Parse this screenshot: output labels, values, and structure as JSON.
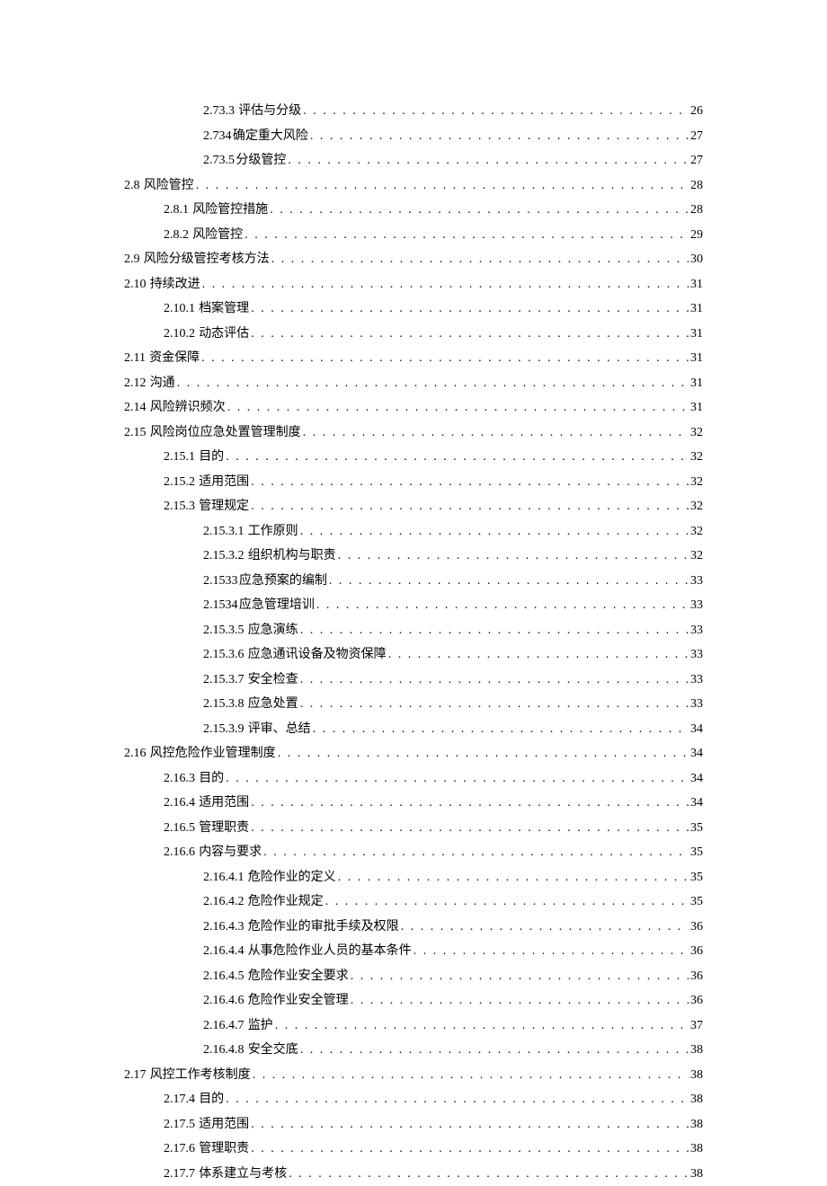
{
  "toc": [
    {
      "indent": 3,
      "num": "2.73.3",
      "title": "评估与分级",
      "page": "26"
    },
    {
      "indent": 3,
      "num": "2.734",
      "title": "确定重大风险",
      "page": "27",
      "tight": true
    },
    {
      "indent": 3,
      "num": "2.73.5",
      "title": "分级管控",
      "page": "27",
      "tight": true
    },
    {
      "indent": 1,
      "num": "2.8",
      "title": "风险管控",
      "page": "28"
    },
    {
      "indent": 2,
      "num": "2.8.1",
      "title": "风险管控措施",
      "page": "28"
    },
    {
      "indent": 2,
      "num": "2.8.2",
      "title": "风险管控",
      "page": "29"
    },
    {
      "indent": 1,
      "num": "2.9",
      "title": "风险分级管控考核方法",
      "page": "30"
    },
    {
      "indent": 1,
      "num": "2.10",
      "title": "持续改进",
      "page": "31"
    },
    {
      "indent": 2,
      "num": "2.10.1",
      "title": "档案管理",
      "page": "31"
    },
    {
      "indent": 2,
      "num": "2.10.2",
      "title": "动态评估",
      "page": "31"
    },
    {
      "indent": 1,
      "num": "2.11",
      "title": "资金保障",
      "page": "31"
    },
    {
      "indent": 1,
      "num": "2.12",
      "title": "沟通",
      "page": "31"
    },
    {
      "indent": 1,
      "num": "2.14",
      "title": "风险辨识频次",
      "page": "31"
    },
    {
      "indent": 1,
      "num": "2.15",
      "title": "风险岗位应急处置管理制度",
      "page": "32"
    },
    {
      "indent": 2,
      "num": "2.15.1",
      "title": "目的",
      "page": "32"
    },
    {
      "indent": 2,
      "num": "2.15.2",
      "title": "适用范围",
      "page": "32"
    },
    {
      "indent": 2,
      "num": "2.15.3",
      "title": "管理规定",
      "page": "32"
    },
    {
      "indent": 3,
      "num": "2.15.3.1",
      "title": "工作原则",
      "page": "32"
    },
    {
      "indent": 3,
      "num": "2.15.3.2",
      "title": "组织机构与职责",
      "page": "32"
    },
    {
      "indent": 3,
      "num": "2.1533",
      "title": "应急预案的编制",
      "page": "33",
      "tight": true
    },
    {
      "indent": 3,
      "num": "2.1534",
      "title": "应急管理培训",
      "page": "33",
      "tight": true
    },
    {
      "indent": 3,
      "num": "2.15.3.5",
      "title": "应急演练",
      "page": "33"
    },
    {
      "indent": 3,
      "num": "2.15.3.6",
      "title": "应急通讯设备及物资保障",
      "page": "33"
    },
    {
      "indent": 3,
      "num": "2.15.3.7",
      "title": "安全检查",
      "page": "33"
    },
    {
      "indent": 3,
      "num": "2.15.3.8",
      "title": "应急处置",
      "page": "33"
    },
    {
      "indent": 3,
      "num": "2.15.3.9",
      "title": "评审、总结",
      "page": "34"
    },
    {
      "indent": 1,
      "num": "2.16",
      "title": "风控危险作业管理制度",
      "page": "34"
    },
    {
      "indent": 2,
      "num": "2.16.3",
      "title": "目的",
      "page": "34"
    },
    {
      "indent": 2,
      "num": "2.16.4",
      "title": "适用范围",
      "page": "34"
    },
    {
      "indent": 2,
      "num": "2.16.5",
      "title": "管理职责",
      "page": "35"
    },
    {
      "indent": 2,
      "num": "2.16.6",
      "title": "内容与要求",
      "page": "35"
    },
    {
      "indent": 3,
      "num": "2.16.4.1",
      "title": "危险作业的定义",
      "page": "35"
    },
    {
      "indent": 3,
      "num": "2.16.4.2",
      "title": "危险作业规定",
      "page": "35"
    },
    {
      "indent": 3,
      "num": "2.16.4.3",
      "title": "危险作业的审批手续及权限",
      "page": "36"
    },
    {
      "indent": 3,
      "num": "2.16.4.4",
      "title": "从事危险作业人员的基本条件",
      "page": "36"
    },
    {
      "indent": 3,
      "num": "2.16.4.5",
      "title": "危险作业安全要求",
      "page": "36"
    },
    {
      "indent": 3,
      "num": "2.16.4.6",
      "title": "危险作业安全管理",
      "page": "36"
    },
    {
      "indent": 3,
      "num": "2.16.4.7",
      "title": "监护",
      "page": "37"
    },
    {
      "indent": 3,
      "num": "2.16.4.8",
      "title": "安全交底",
      "page": "38"
    },
    {
      "indent": 1,
      "num": "2.17",
      "title": "风控工作考核制度",
      "page": "38"
    },
    {
      "indent": 2,
      "num": "2.17.4",
      "title": "目的",
      "page": "38"
    },
    {
      "indent": 2,
      "num": "2.17.5",
      "title": "适用范围",
      "page": "38"
    },
    {
      "indent": 2,
      "num": "2.17.6",
      "title": "管理职责",
      "page": "38"
    },
    {
      "indent": 2,
      "num": "2.17.7",
      "title": "体系建立与考核",
      "page": "38"
    }
  ]
}
